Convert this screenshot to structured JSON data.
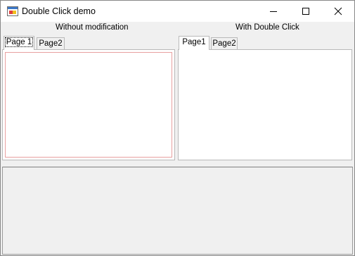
{
  "window": {
    "title": "Double Click demo",
    "icon": "winforms-app-icon",
    "controls": {
      "minimize": "minimize-icon",
      "maximize": "maximize-icon",
      "close": "close-icon"
    }
  },
  "left_group": {
    "label": "Without modification",
    "tabs": [
      {
        "label": "Page 1",
        "selected": true
      },
      {
        "label": "Page2",
        "selected": false
      }
    ]
  },
  "right_group": {
    "label": "With Double Click",
    "tabs": [
      {
        "label": "Page1",
        "selected": true
      },
      {
        "label": "Page2",
        "selected": false
      }
    ]
  },
  "colors": {
    "window_bg": "#f0f0f0",
    "titlebar_bg": "#ffffff",
    "tab_border": "#b9b9b9",
    "inner_box_border": "#e8a0a0"
  }
}
